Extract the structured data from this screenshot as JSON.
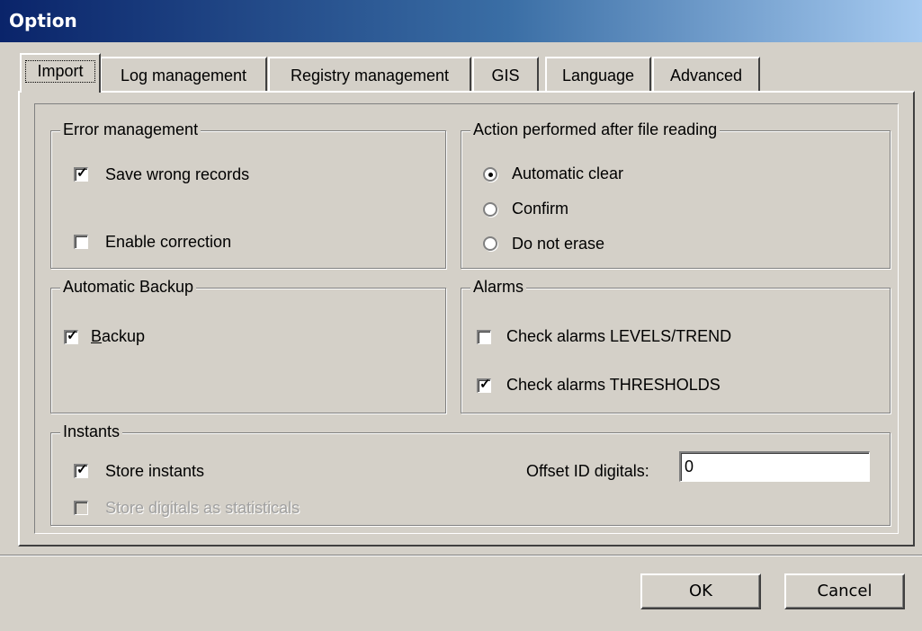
{
  "window": {
    "title": "Option"
  },
  "tabs": [
    {
      "label": "Import"
    },
    {
      "label": "Log management"
    },
    {
      "label": "Registry management"
    },
    {
      "label": "GIS"
    },
    {
      "label": "Language"
    },
    {
      "label": "Advanced"
    }
  ],
  "error_management": {
    "title": "Error management",
    "save_wrong_records": {
      "label": "Save wrong records",
      "checked": true
    },
    "enable_correction": {
      "label": "Enable correction",
      "checked": false
    }
  },
  "action_after_reading": {
    "title": "Action performed after file reading",
    "options": [
      {
        "label": "Automatic clear",
        "selected": true
      },
      {
        "label": "Confirm",
        "selected": false
      },
      {
        "label": "Do not erase",
        "selected": false
      }
    ]
  },
  "automatic_backup": {
    "title": "Automatic Backup",
    "backup": {
      "label_accel": "B",
      "label_rest": "ackup",
      "checked": true
    }
  },
  "alarms": {
    "title": "Alarms",
    "levels_trend": {
      "label": "Check alarms LEVELS/TREND",
      "checked": false
    },
    "thresholds": {
      "label": "Check alarms THRESHOLDS",
      "checked": true
    }
  },
  "instants": {
    "title": "Instants",
    "store_instants": {
      "label": "Store instants",
      "checked": true
    },
    "store_digitals": {
      "label": "Store digitals as statisticals",
      "checked": false,
      "enabled": false
    },
    "offset_label": "Offset ID digitals:",
    "offset_value": "0"
  },
  "buttons": {
    "ok": "OK",
    "cancel": "Cancel"
  }
}
